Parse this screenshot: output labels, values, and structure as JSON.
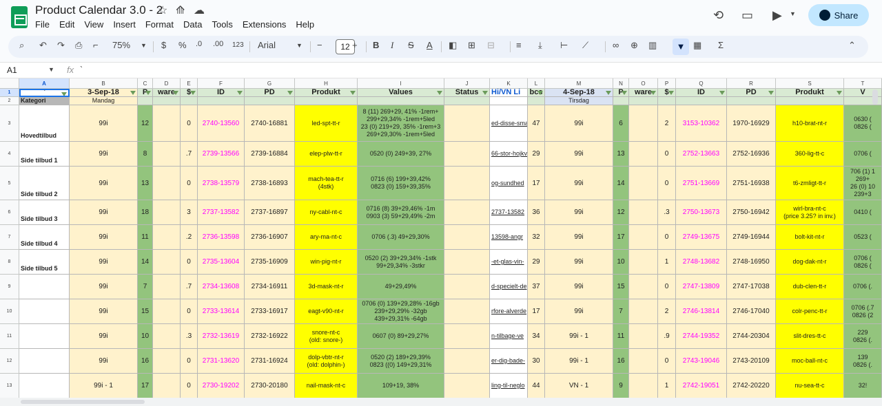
{
  "app": {
    "title": "Product Calendar 3.0 - 2",
    "menu": [
      "File",
      "Edit",
      "View",
      "Insert",
      "Format",
      "Data",
      "Tools",
      "Extensions",
      "Help"
    ],
    "share_label": "Share"
  },
  "toolbar": {
    "zoom": "75%",
    "currency": "$",
    "percent": "%",
    "decrease_decimals": ".0",
    "increase_decimals": ".00",
    "number_format": "123",
    "font": "Arial",
    "font_size": "12",
    "bold": "B",
    "italic": "I",
    "strikethrough": "S",
    "text_color": "A",
    "sum": "Σ"
  },
  "formula_bar": {
    "cell_ref": "A1",
    "fx": "fx",
    "content": "`"
  },
  "columns": [
    "A",
    "B",
    "C",
    "D",
    "E",
    "F",
    "G",
    "H",
    "I",
    "J",
    "K",
    "L",
    "M",
    "N",
    "O",
    "P",
    "Q",
    "R",
    "S",
    "T"
  ],
  "header_row": [
    "`",
    "3-Sep-18",
    "P",
    "ware",
    "$",
    "ID",
    "PD",
    "Produkt",
    "Values",
    "Status",
    "Hi/VN Li",
    "bcs",
    "4-Sep-18",
    "P",
    "ware",
    "$",
    "ID",
    "PD",
    "Produkt",
    "V"
  ],
  "subheader_row": [
    "Kategori",
    "Mandag",
    "",
    "",
    "",
    "",
    "",
    "",
    "",
    "",
    "",
    "",
    "Tirsdag",
    "",
    "",
    "",
    "",
    "",
    "",
    ""
  ],
  "rows": [
    {
      "num": "3",
      "a": "Hovedtilbud",
      "b": "99i",
      "c": "12",
      "e": "0",
      "f": "2740-13560",
      "g": "2740-16881",
      "h": "led-spt-tt-r",
      "i": "8 (11) 269+29, 41% -1rem+\n299+29,34% -1rem+5led\n23 (0) 219+29, 35% -1rem+3\n269+29,30% -1rem+5led",
      "k": "ed-disse-sma",
      "l": "47",
      "m": "99i",
      "n": "6",
      "p": "2",
      "q": "3153-10362",
      "r": "1970-16929",
      "s": "h10-brat-nt-r",
      "t": "0630 (\n0826 ("
    },
    {
      "num": "4",
      "a": "Side tilbud 1",
      "b": "99i",
      "c": "8",
      "e": ".7",
      "f": "2739-13566",
      "g": "2739-16884",
      "h": "elep-plw-tt-r",
      "i": "0520 (0) 249+39, 27%",
      "k": "66-stor-hojkv",
      "l": "29",
      "m": "99i",
      "n": "13",
      "p": "0",
      "q": "2752-13663",
      "r": "2752-16936",
      "s": "360-lig-tt-c",
      "t": "0706 ("
    },
    {
      "num": "5",
      "a": "Side tilbud 2",
      "b": "99i",
      "c": "13",
      "e": "0",
      "f": "2738-13579",
      "g": "2738-16893",
      "h": "mach-tea-tt-r\n(4stk)",
      "i": "0716 (6) 199+39,42%\n0823 (0) 159+39,35%",
      "k": "og-sundhed",
      "l": "17",
      "m": "99i",
      "n": "14",
      "p": "0",
      "q": "2751-13669",
      "r": "2751-16938",
      "s": "t6-zmligt-tt-r",
      "t": "706 (1) 1\n269+\n26 (0) 10\n239+3"
    },
    {
      "num": "6",
      "a": "Side tilbud 3",
      "b": "99i",
      "c": "18",
      "e": "3",
      "f": "2737-13582",
      "g": "2737-16897",
      "h": "ny-cabl-nt-c",
      "i": "0716 (8) 39+29,46% -1m\n0903 (3) 59+29,49% -2m",
      "k": "2737-13582",
      "l": "36",
      "m": "99i",
      "n": "12",
      "p": ".3",
      "q": "2750-13673",
      "r": "2750-16942",
      "s": "wirl-bra-nt-c\n(price 3.25? in inv.)",
      "t": "0410 ("
    },
    {
      "num": "7",
      "a": "Side tilbud 4",
      "b": "99i",
      "c": "11",
      "e": ".2",
      "f": "2736-13598",
      "g": "2736-16907",
      "h": "ary-ma-nt-c",
      "i": "0706 (.3) 49+29,30%",
      "k": "13598-angr",
      "l": "32",
      "m": "99i",
      "n": "17",
      "p": "0",
      "q": "2749-13675",
      "r": "2749-16944",
      "s": "bolt-kit-nt-r",
      "t": "0523 ("
    },
    {
      "num": "8",
      "a": "Side tilbud 5",
      "b": "99i",
      "c": "14",
      "e": "0",
      "f": "2735-13604",
      "g": "2735-16909",
      "h": "win-pig-nt-r",
      "i": "0520 (2) 39+29,34% -1stk\n99+29,34% -3stkr",
      "k": "-et-glas-vin-",
      "l": "29",
      "m": "99i",
      "n": "10",
      "p": "1",
      "q": "2748-13682",
      "r": "2748-16950",
      "s": "dog-dak-nt-r",
      "t": "0706 (\n0826 ("
    },
    {
      "num": "9",
      "a": "",
      "b": "99i",
      "c": "7",
      "e": ".7",
      "f": "2734-13608",
      "g": "2734-16911",
      "h": "3d-mask-nt-r",
      "i": "49+29,49%",
      "k": "d-specielt-de",
      "l": "37",
      "m": "99i",
      "n": "15",
      "p": "0",
      "q": "2747-13809",
      "r": "2747-17038",
      "s": "dub-clen-tt-r",
      "t": "0706 (."
    },
    {
      "num": "10",
      "a": "",
      "b": "99i",
      "c": "15",
      "e": "0",
      "f": "2733-13614",
      "g": "2733-16917",
      "h": "eagt-v90-nt-r",
      "i": "0706 (0) 139+29,28% -16gb\n239+29,29% -32gb\n439+29,31% -64gb",
      "k": "rfore-alverde",
      "l": "17",
      "m": "99i",
      "n": "7",
      "p": "2",
      "q": "2746-13814",
      "r": "2746-17040",
      "s": "colr-penc-tt-r",
      "t": "0706 (.7\n0826 (2"
    },
    {
      "num": "11",
      "a": "",
      "b": "99i",
      "c": "10",
      "e": ".3",
      "f": "2732-13619",
      "g": "2732-16922",
      "h": "snore-nt-c\n(old: snore-)",
      "i": "0607 (0) 89+29,27%",
      "k": "n-tilbage-ve",
      "l": "34",
      "m": "99i - 1",
      "n": "11",
      "p": ".9",
      "q": "2744-19352",
      "r": "2744-20304",
      "s": "slit-dres-tt-c",
      "t": "229\n0826 (."
    },
    {
      "num": "12",
      "a": "",
      "b": "99i",
      "c": "16",
      "e": "0",
      "f": "2731-13620",
      "g": "2731-16924",
      "h": "dolp-vbtr-nt-r\n(old: dolphin-)",
      "i": "0520 (2) 189+29,39%\n0823 ((0) 149+29,31%",
      "k": "er-dig-bade-",
      "l": "30",
      "m": "99i - 1",
      "n": "16",
      "p": "0",
      "q": "2743-19046",
      "r": "2743-20109",
      "s": "moc-ball-nt-c",
      "t": "139\n0826 (."
    },
    {
      "num": "13",
      "a": "",
      "b": "99i - 1",
      "c": "17",
      "e": "0",
      "f": "2730-19202",
      "g": "2730-20180",
      "h": "nail-mask-nt-c",
      "i": "109+19, 38%",
      "k": "ling-til-neglo",
      "l": "44",
      "m": "VN - 1",
      "n": "9",
      "p": "1",
      "q": "2742-19051",
      "r": "2742-20220",
      "s": "nu-sea-tt-c",
      "t": "32!"
    }
  ]
}
